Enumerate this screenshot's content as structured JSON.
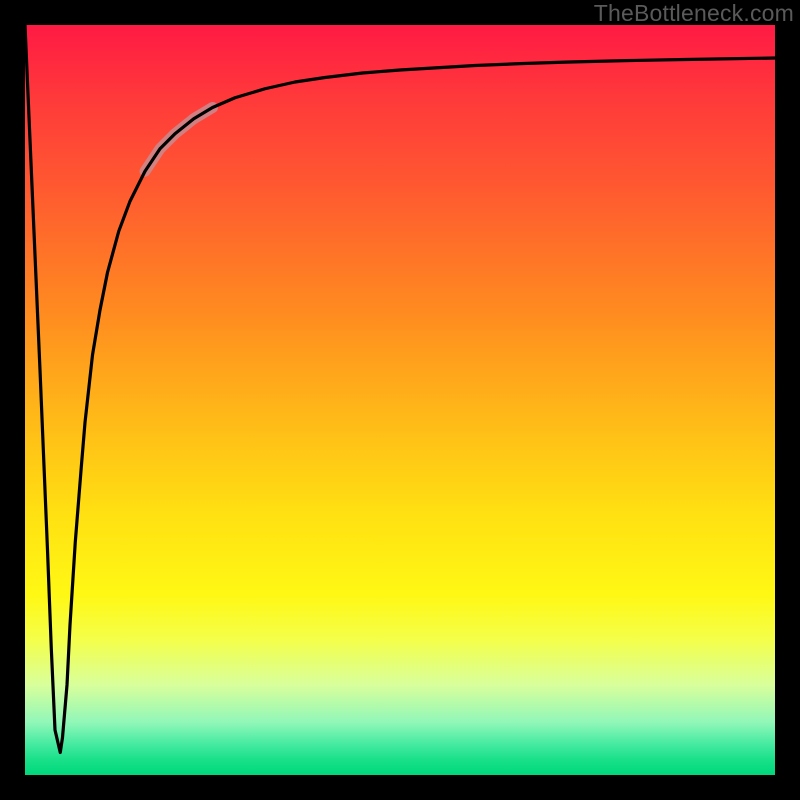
{
  "watermark": "TheBottleneck.com",
  "colors": {
    "frame": "#000000",
    "curve": "#000000",
    "highlight": "#c98b8f",
    "gradient_top": "#ff1a44",
    "gradient_bottom": "#00d87b"
  },
  "chart_data": {
    "type": "line",
    "title": "",
    "xlabel": "",
    "ylabel": "",
    "xlim": [
      0,
      100
    ],
    "ylim": [
      0,
      100
    ],
    "grid": false,
    "legend": false,
    "series": [
      {
        "name": "main-curve",
        "x": [
          0.0,
          1.0,
          2.0,
          3.0,
          3.5,
          4.0,
          4.7,
          5.0,
          5.6,
          6.0,
          6.7,
          7.5,
          8.0,
          9.0,
          10.0,
          11.0,
          12.5,
          14.0,
          16.0,
          18.0,
          20.0,
          22.5,
          25.0,
          28.0,
          32.0,
          36.0,
          40.0,
          45.0,
          50.0,
          55.0,
          60.0,
          66.0,
          72.0,
          80.0,
          88.0,
          94.0,
          100.0
        ],
        "y": [
          100.0,
          77.0,
          54.0,
          30.0,
          17.0,
          6.0,
          3.0,
          5.0,
          12.0,
          20.0,
          31.0,
          41.0,
          47.0,
          56.0,
          62.0,
          67.0,
          72.5,
          76.5,
          80.5,
          83.5,
          85.5,
          87.5,
          89.0,
          90.3,
          91.5,
          92.4,
          93.0,
          93.6,
          94.0,
          94.3,
          94.6,
          94.85,
          95.05,
          95.25,
          95.4,
          95.5,
          95.6
        ]
      },
      {
        "name": "highlight-segment",
        "x": [
          16.0,
          18.0,
          20.0,
          22.5,
          25.0
        ],
        "y": [
          80.5,
          83.5,
          85.5,
          87.5,
          89.0
        ]
      }
    ],
    "annotations": []
  }
}
